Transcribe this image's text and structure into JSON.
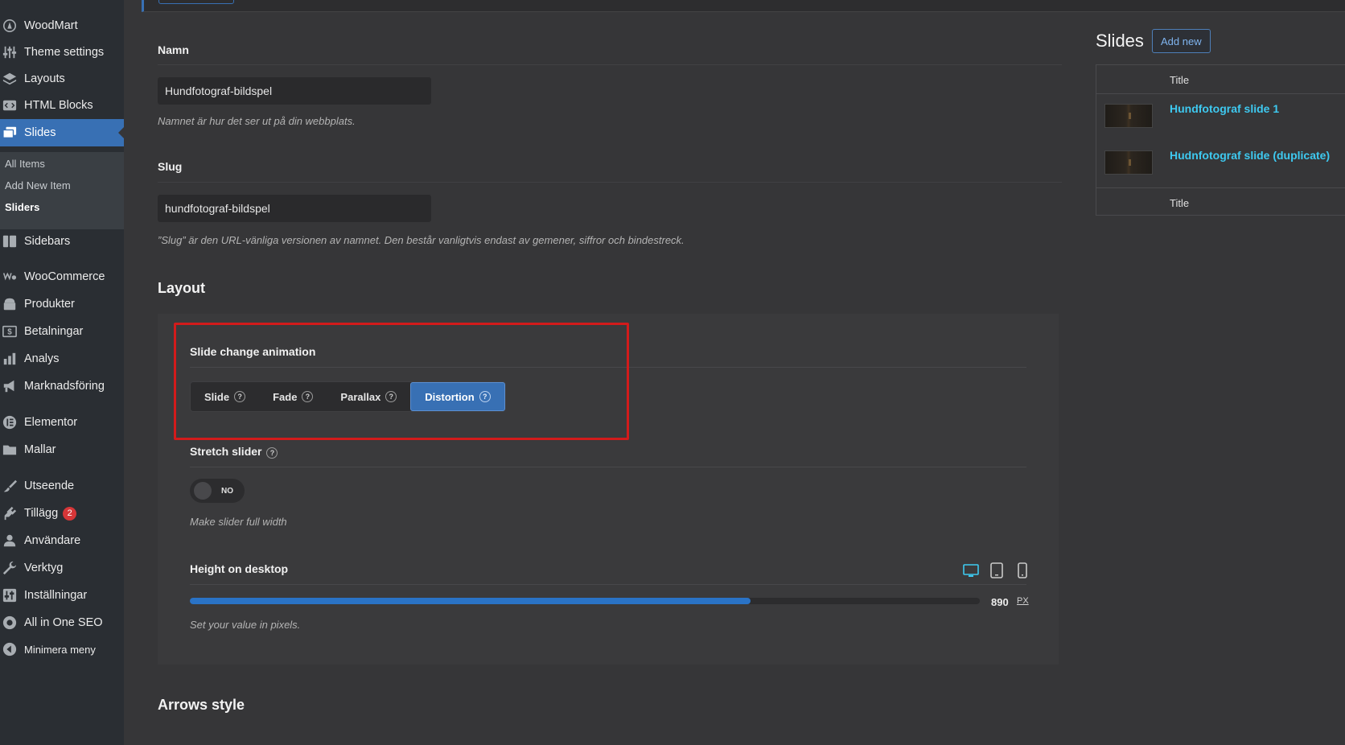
{
  "sidebar": {
    "items": [
      {
        "label": "WoodMart",
        "icon": "woodmart-icon"
      },
      {
        "label": "Theme settings",
        "icon": "sliders-icon"
      },
      {
        "label": "Layouts",
        "icon": "layers-icon"
      },
      {
        "label": "HTML Blocks",
        "icon": "code-block-icon"
      },
      {
        "label": "Slides",
        "icon": "slides-icon"
      },
      {
        "label": "Sidebars",
        "icon": "sidebar-icon"
      },
      {
        "label": "WooCommerce",
        "icon": "woocommerce-icon"
      },
      {
        "label": "Produkter",
        "icon": "archive-icon"
      },
      {
        "label": "Betalningar",
        "icon": "dollar-icon"
      },
      {
        "label": "Analys",
        "icon": "bar-chart-icon"
      },
      {
        "label": "Marknadsföring",
        "icon": "megaphone-icon"
      },
      {
        "label": "Elementor",
        "icon": "elementor-icon"
      },
      {
        "label": "Mallar",
        "icon": "folder-icon"
      },
      {
        "label": "Utseende",
        "icon": "brush-icon"
      },
      {
        "label": "Tillägg",
        "icon": "plugin-icon",
        "badge": "2"
      },
      {
        "label": "Användare",
        "icon": "user-icon"
      },
      {
        "label": "Verktyg",
        "icon": "wrench-icon"
      },
      {
        "label": "Inställningar",
        "icon": "settings-icon"
      },
      {
        "label": "All in One SEO",
        "icon": "seo-icon"
      },
      {
        "label": "Minimera meny",
        "icon": "collapse-icon"
      }
    ],
    "submenu": [
      "All Items",
      "Add New Item",
      "Sliders"
    ]
  },
  "form": {
    "name_label": "Namn",
    "name_value": "Hundfotograf-bildspel",
    "name_desc": "Namnet är hur det ser ut på din webbplats.",
    "slug_label": "Slug",
    "slug_value": "hundfotograf-bildspel",
    "slug_desc": "”Slug” är den URL-vänliga versionen av namnet. Den består vanligtvis endast av gemener, siffror och bindestreck."
  },
  "layout": {
    "title": "Layout",
    "animation_label": "Slide change animation",
    "animation_options": [
      "Slide",
      "Fade",
      "Parallax",
      "Distortion"
    ],
    "animation_selected": "Distortion",
    "stretch_label": "Stretch slider",
    "stretch_value": "NO",
    "stretch_desc": "Make slider full width",
    "height_label": "Height on desktop",
    "height_value": "890",
    "height_unit": "PX",
    "height_fraction": 0.71,
    "height_desc": "Set your value in pixels.",
    "devices": [
      "desktop-icon",
      "tablet-icon",
      "mobile-icon"
    ]
  },
  "arrows": {
    "title": "Arrows style"
  },
  "slides": {
    "title": "Slides",
    "add_new": "Add new",
    "header": "Title",
    "footer": "Title",
    "rows": [
      "Hundfotograf slide 1",
      "Hudnfotograf slide (duplicate)"
    ]
  },
  "colors": {
    "accent": "#3870b4",
    "link": "#3ec9f0",
    "highlight": "#d21b1b",
    "badge": "#d63638"
  }
}
